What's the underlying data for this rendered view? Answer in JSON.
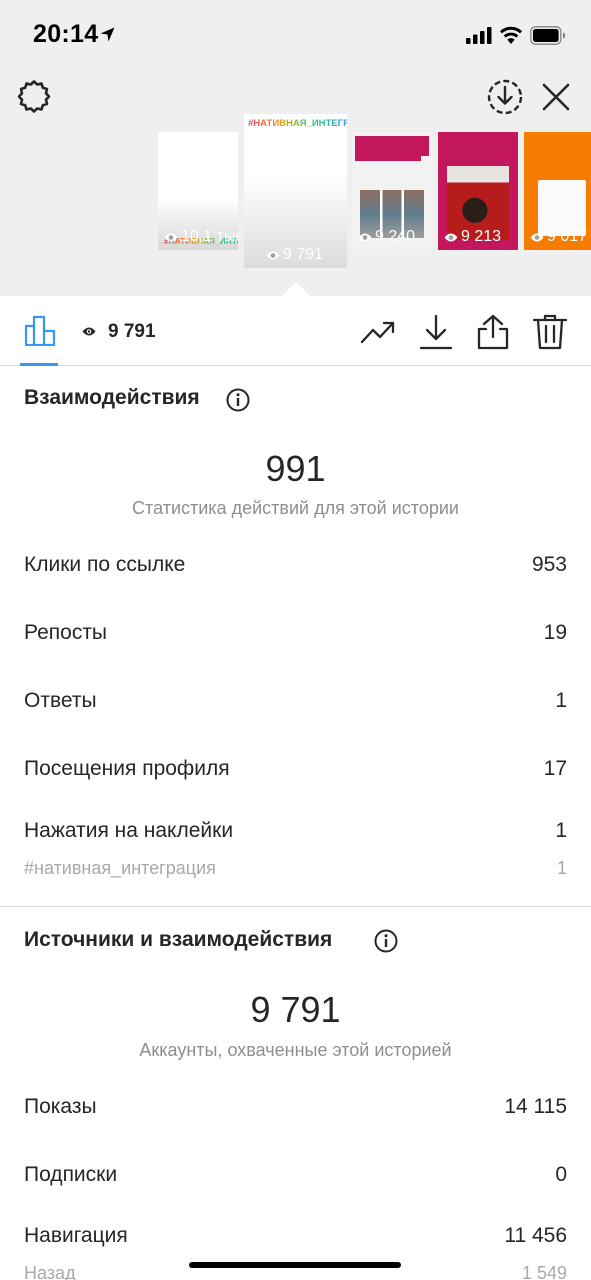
{
  "status_bar": {
    "time": "20:14"
  },
  "stories": [
    {
      "views": "10,1 тыс.",
      "tag": "#НАТИВНАЯ_ИНТЕГРАЦИЯ"
    },
    {
      "views": "9 791",
      "tag": "#НАТИВНАЯ_ИНТЕГРАЦИЯ",
      "selected": true
    },
    {
      "views": "9 240"
    },
    {
      "views": "9 213"
    },
    {
      "views": "9 017"
    }
  ],
  "toolbar": {
    "views": "9 791",
    "accent": "#3897f0"
  },
  "interactions": {
    "title": "Взаимодействия",
    "total": "991",
    "subtitle": "Статистика действий для этой истории",
    "rows": [
      {
        "label": "Клики по ссылке",
        "value": "953"
      },
      {
        "label": "Репосты",
        "value": "19"
      },
      {
        "label": "Ответы",
        "value": "1"
      },
      {
        "label": "Посещения профиля",
        "value": "17"
      },
      {
        "label": "Нажатия на наклейки",
        "value": "1"
      }
    ],
    "sticker": {
      "label": "#нативная_интеграция",
      "value": "1"
    }
  },
  "sources": {
    "title": "Источники и взаимодействия",
    "total": "9 791",
    "subtitle": "Аккаунты, охваченные этой историей",
    "rows": [
      {
        "label": "Показы",
        "value": "14 115"
      },
      {
        "label": "Подписки",
        "value": "0"
      },
      {
        "label": "Навигация",
        "value": "11 456"
      }
    ],
    "sub": {
      "label": "Назад",
      "value": "1 549"
    }
  },
  "icons": [
    "location-arrow-icon",
    "signal-icon",
    "wifi-icon",
    "battery-icon",
    "gear-icon",
    "download-circle-icon",
    "close-icon",
    "eye-icon",
    "bar-chart-icon",
    "trend-icon",
    "download-icon",
    "share-icon",
    "trash-icon",
    "info-icon"
  ]
}
